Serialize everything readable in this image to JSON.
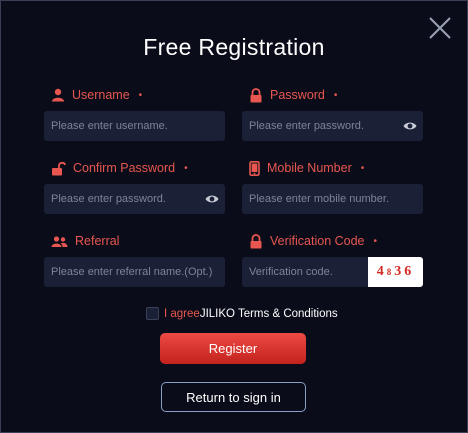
{
  "title": "Free Registration",
  "fields": {
    "username": {
      "label": "Username",
      "required": "•",
      "placeholder": "Please enter username.",
      "icon": "user-icon"
    },
    "password": {
      "label": "Password",
      "required": "•",
      "placeholder": "Please enter password.",
      "icon": "lock-icon"
    },
    "confirm_password": {
      "label": "Confirm Password",
      "required": "•",
      "placeholder": "Please enter password.",
      "icon": "unlock-icon"
    },
    "mobile": {
      "label": "Mobile Number",
      "required": "•",
      "placeholder": "Please enter mobile number.",
      "icon": "phone-icon"
    },
    "referral": {
      "label": "Referral",
      "placeholder": "Please enter referral name.(Opt.)",
      "icon": "group-icon"
    },
    "verification": {
      "label": "Verification Code",
      "required": "•",
      "placeholder": "Verification code.",
      "icon": "lock-icon",
      "captcha_digits": [
        "4",
        "8",
        "3",
        "6"
      ]
    }
  },
  "agree": {
    "prefix": "I agree",
    "link": "JILIKO Terms & Conditions"
  },
  "buttons": {
    "register": "Register",
    "return": "Return to sign in"
  },
  "colors": {
    "accent": "#e8574f",
    "input_bg": "#1a2035",
    "modal_bg": "#0a0c1a"
  }
}
